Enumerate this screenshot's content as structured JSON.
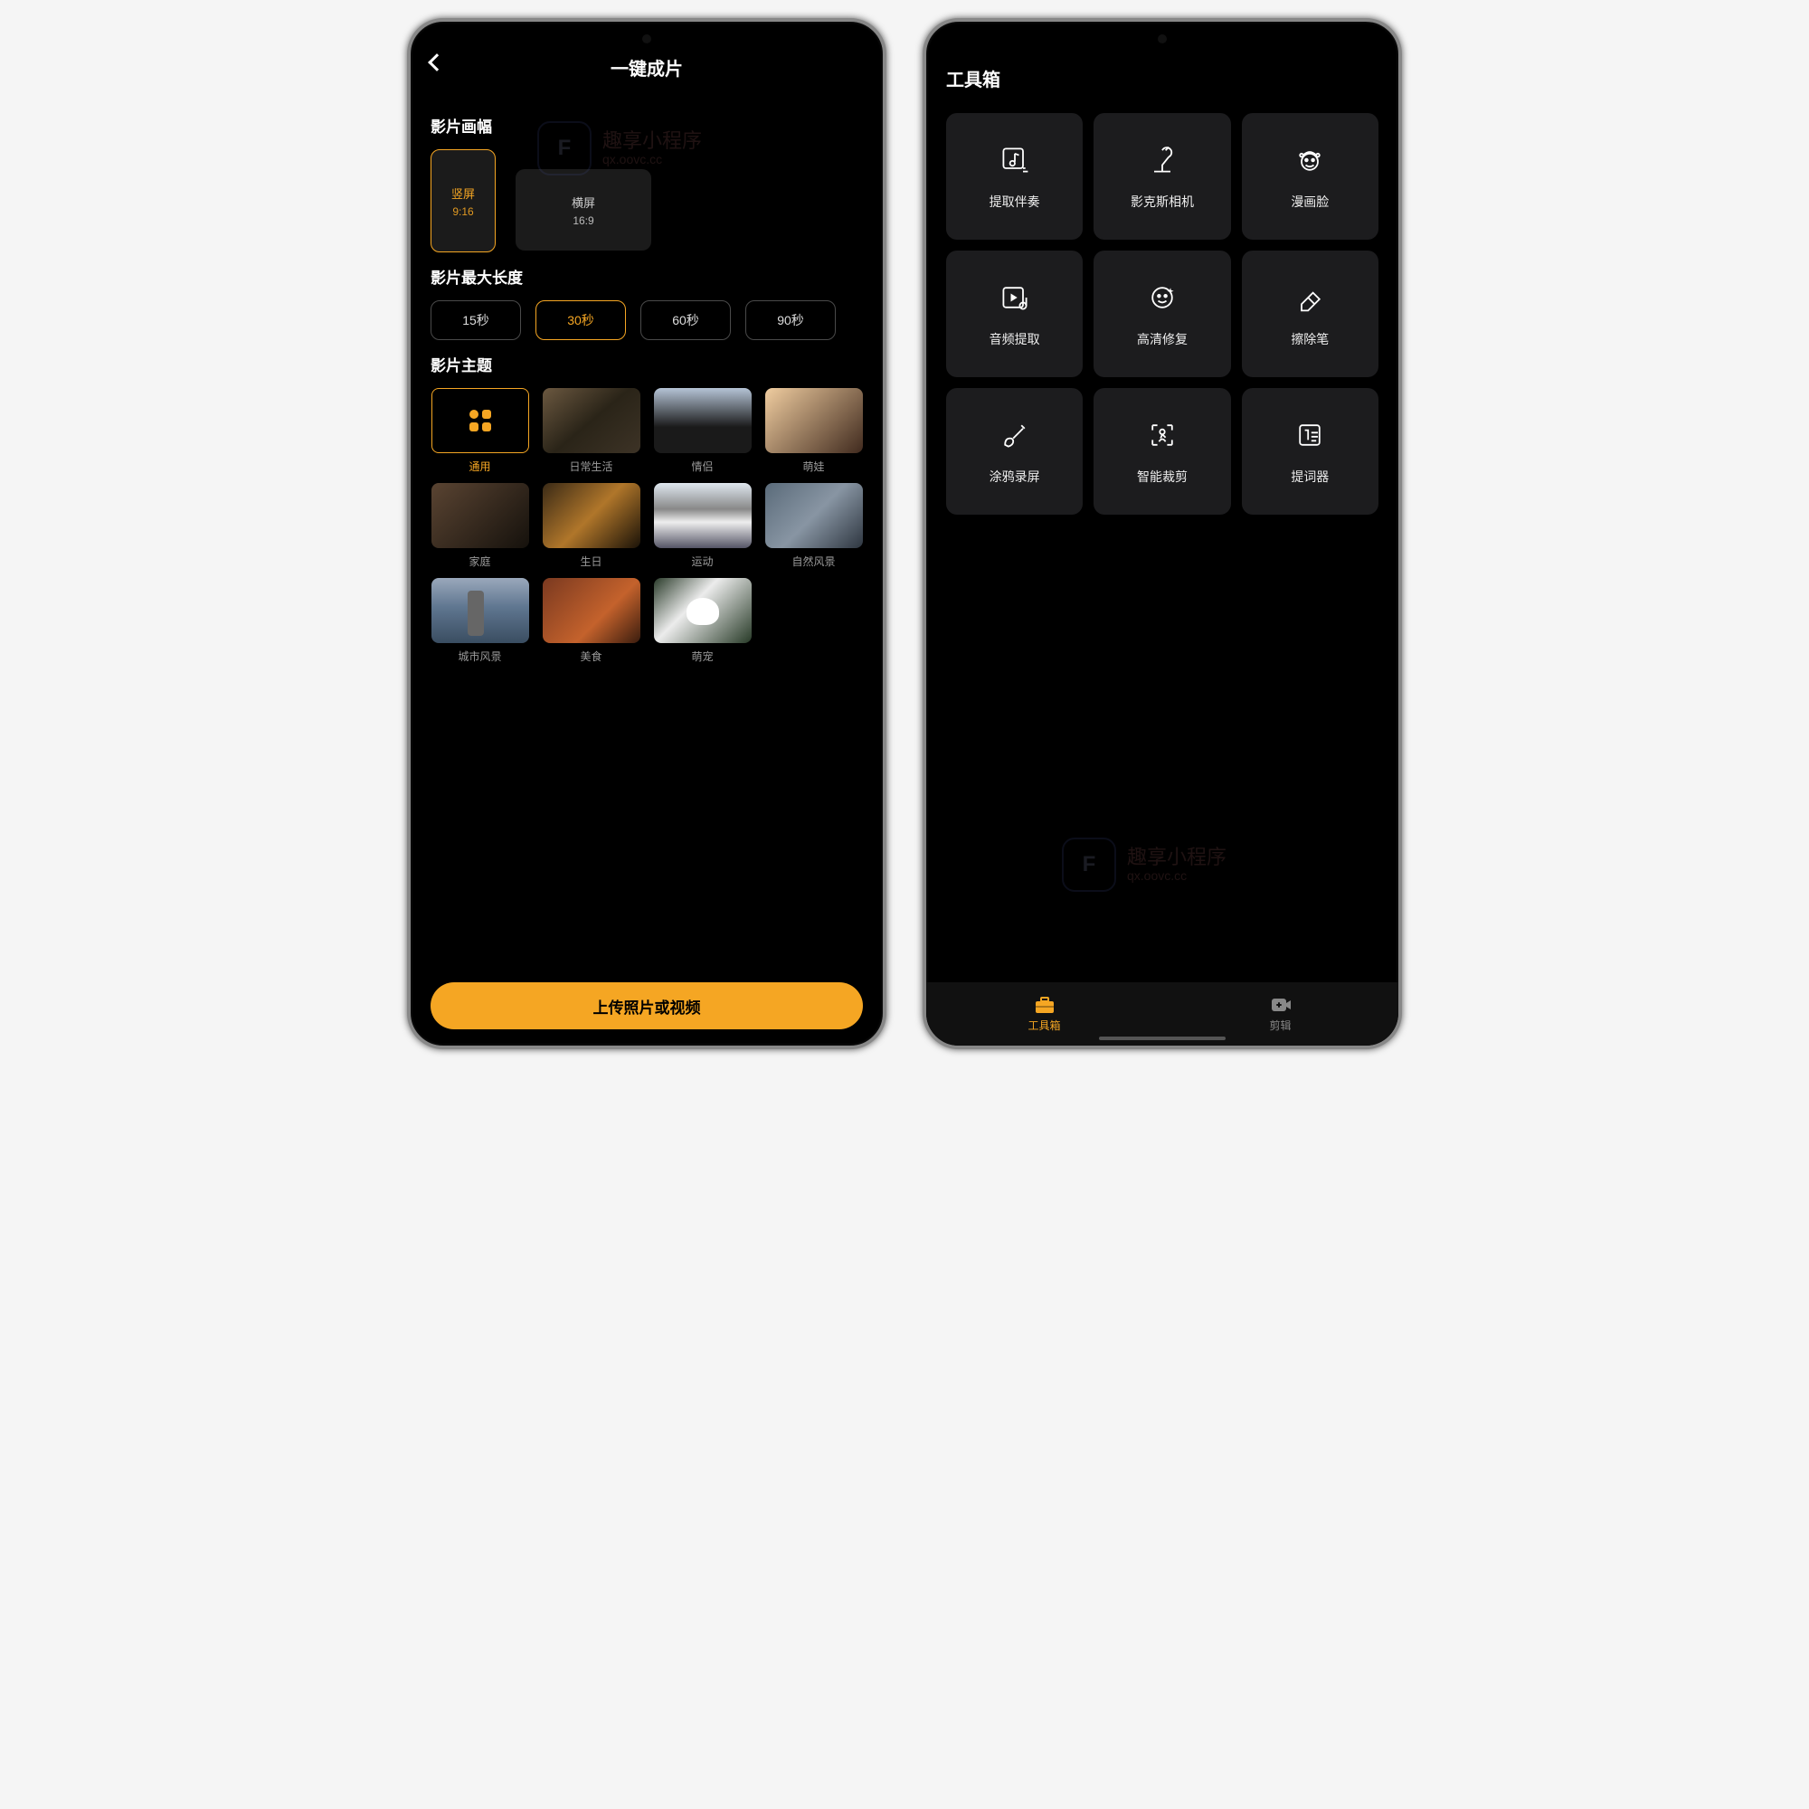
{
  "watermark": {
    "text": "趣享小程序",
    "url": "qx.oovc.cc",
    "logo": "F"
  },
  "left": {
    "header": {
      "title": "一键成片"
    },
    "aspect": {
      "section": "影片画幅",
      "vertical": {
        "label": "竖屏",
        "ratio": "9:16"
      },
      "horizontal": {
        "label": "横屏",
        "ratio": "16:9"
      }
    },
    "duration": {
      "section": "影片最大长度",
      "options": [
        "15秒",
        "30秒",
        "60秒",
        "90秒"
      ],
      "selected_index": 1
    },
    "theme": {
      "section": "影片主题",
      "items": [
        {
          "label": "通用",
          "selected": true
        },
        {
          "label": "日常生活"
        },
        {
          "label": "情侣"
        },
        {
          "label": "萌娃"
        },
        {
          "label": "家庭"
        },
        {
          "label": "生日"
        },
        {
          "label": "运动"
        },
        {
          "label": "自然风景"
        },
        {
          "label": "城市风景"
        },
        {
          "label": "美食"
        },
        {
          "label": "萌宠"
        }
      ]
    },
    "upload_label": "上传照片或视频"
  },
  "right": {
    "title": "工具箱",
    "tools": [
      {
        "name": "extract-accompaniment",
        "label": "提取伴奏"
      },
      {
        "name": "yingkesi-camera",
        "label": "影克斯相机"
      },
      {
        "name": "cartoon-face",
        "label": "漫画脸"
      },
      {
        "name": "audio-extract",
        "label": "音频提取"
      },
      {
        "name": "hd-restore",
        "label": "高清修复"
      },
      {
        "name": "eraser",
        "label": "擦除笔"
      },
      {
        "name": "doodle-record",
        "label": "涂鸦录屏"
      },
      {
        "name": "smart-crop",
        "label": "智能裁剪"
      },
      {
        "name": "teleprompter",
        "label": "提词器"
      }
    ],
    "nav": {
      "toolbox": "工具箱",
      "edit": "剪辑"
    }
  }
}
